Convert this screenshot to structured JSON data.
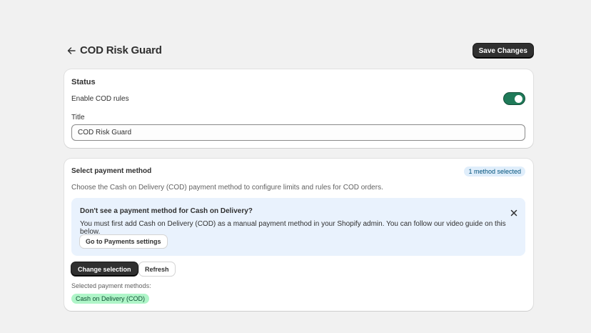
{
  "header": {
    "title": "COD Risk Guard",
    "save_label": "Save Changes"
  },
  "status_card": {
    "heading": "Status",
    "enable_label": "Enable COD rules",
    "enable_value": true,
    "title_label": "Title",
    "title_value": "COD Risk Guard"
  },
  "payment_card": {
    "heading": "Select payment method",
    "badge": "1 method selected",
    "description": "Choose the Cash on Delivery (COD) payment method to configure limits and rules for COD orders.",
    "banner": {
      "title": "Don't see a payment method for Cash on Delivery?",
      "text": "You must first add Cash on Delivery (COD) as a manual payment method in your Shopify admin. You can follow our video guide on this below.",
      "button": "Go to Payments settings"
    },
    "change_button": "Change selection",
    "refresh_button": "Refresh",
    "selected_label": "Selected payment methods:",
    "selected_methods": [
      "Cash on Delivery (COD)"
    ]
  },
  "colors": {
    "background": "#f1f1f1",
    "toggle_on": "#1f7a59",
    "banner_bg": "#e9f2fd",
    "badge_bg": "#e0eefb",
    "pill_bg": "#aff5c8",
    "primary_button": "#303030"
  },
  "icons": {
    "back": "arrow-left-icon",
    "close": "close-icon"
  }
}
